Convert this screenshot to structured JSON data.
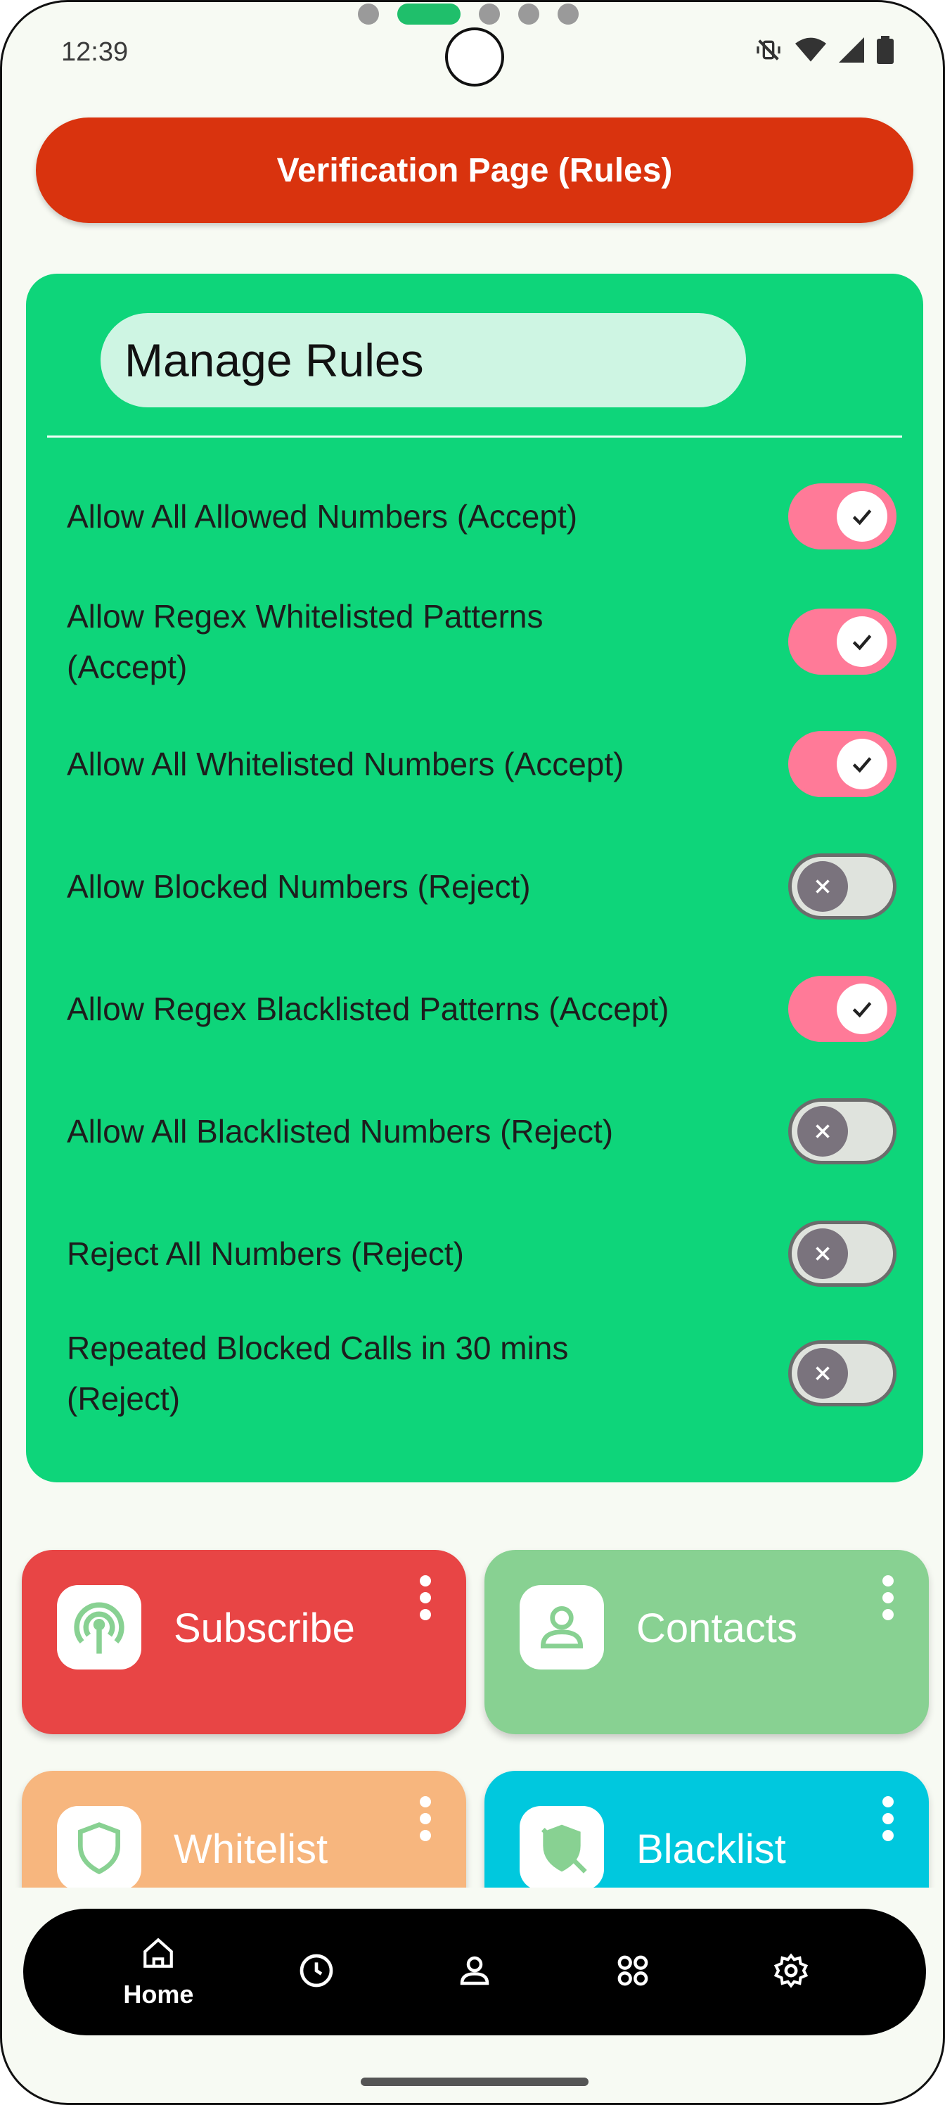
{
  "status_bar": {
    "time": "12:39"
  },
  "header": {
    "title": "Verification Page (Rules)"
  },
  "rules_card": {
    "title": "Manage Rules",
    "rules": [
      {
        "label": "Allow All Allowed Numbers (Accept)",
        "enabled": true
      },
      {
        "label": "Allow Regex Whitelisted Patterns (Accept)",
        "enabled": true
      },
      {
        "label": "Allow All Whitelisted Numbers (Accept)",
        "enabled": true
      },
      {
        "label": "Allow Blocked Numbers (Reject)",
        "enabled": false
      },
      {
        "label": "Allow Regex Blacklisted Patterns (Accept)",
        "enabled": true
      },
      {
        "label": "Allow All Blacklisted Numbers (Reject)",
        "enabled": false
      },
      {
        "label": "Reject All Numbers (Reject)",
        "enabled": false
      },
      {
        "label": "Repeated Blocked Calls in 30 mins (Reject)",
        "enabled": false
      }
    ]
  },
  "tiles": [
    {
      "label": "Subscribe",
      "icon": "broadcast-icon",
      "color": "#e84545"
    },
    {
      "label": "Contacts",
      "icon": "person-icon",
      "color": "#88d192"
    },
    {
      "label": "Whitelist",
      "icon": "shield-icon",
      "color": "#f7b67e"
    },
    {
      "label": "Blacklist",
      "icon": "shield-blocked-icon",
      "color": "#00c8de"
    }
  ],
  "bottom_nav": {
    "items": [
      {
        "label": "Home",
        "icon": "home-icon",
        "active": true
      },
      {
        "label": "",
        "icon": "history-icon",
        "active": false
      },
      {
        "label": "",
        "icon": "person-icon",
        "active": false
      },
      {
        "label": "",
        "icon": "apps-icon",
        "active": false
      },
      {
        "label": "",
        "icon": "settings-icon",
        "active": false
      }
    ]
  },
  "colors": {
    "header": "#d9330e",
    "card": "#0ed57a",
    "toggle_on": "#ff7a98",
    "toggle_off": "#dfe3dd"
  }
}
